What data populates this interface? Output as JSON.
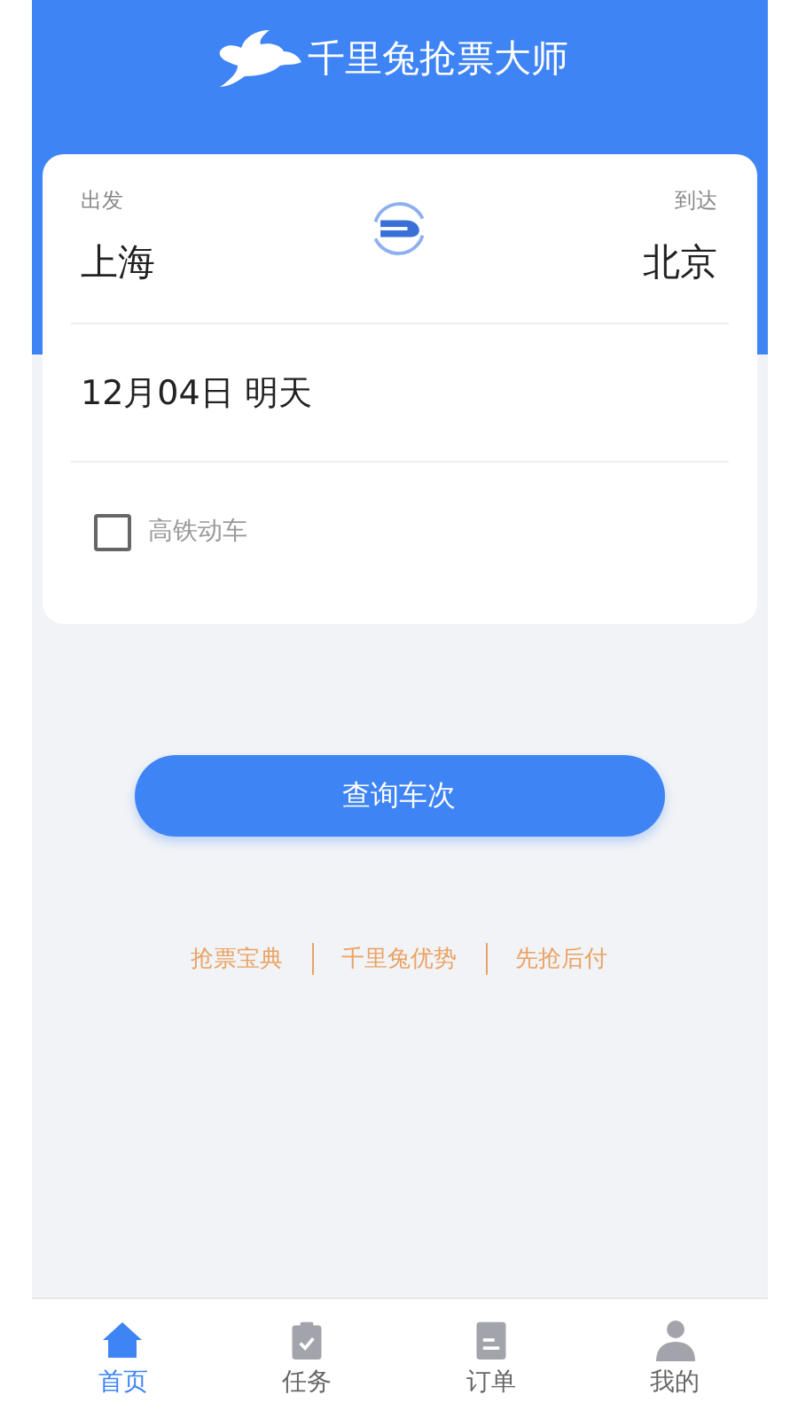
{
  "header": {
    "title": "千里兔抢票大师"
  },
  "search_card": {
    "from_label": "出发",
    "to_label": "到达",
    "from_city": "上海",
    "to_city": "北京",
    "date": "12月04日 明天",
    "high_speed": {
      "label": "高铁动车",
      "checked": false
    }
  },
  "search_button": "查询车次",
  "links": [
    "抢票宝典",
    "千里兔优势",
    "先抢后付"
  ],
  "tabs": [
    {
      "label": "首页",
      "kind": "home",
      "selected": true
    },
    {
      "label": "任务",
      "kind": "task",
      "selected": false
    },
    {
      "label": "订单",
      "kind": "order",
      "selected": false
    },
    {
      "label": "我的",
      "kind": "profile",
      "selected": false
    }
  ]
}
